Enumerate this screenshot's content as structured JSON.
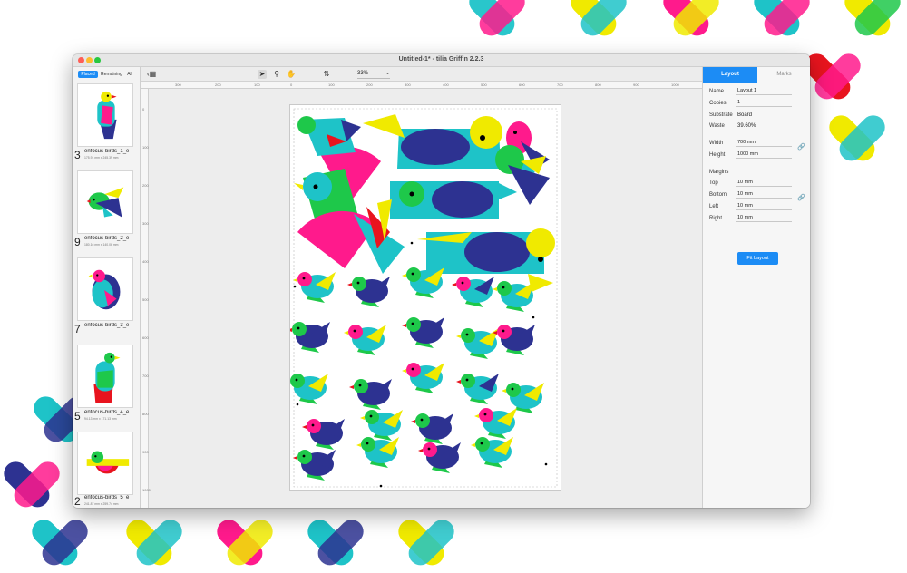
{
  "window": {
    "title": "Untitled-1* - tilia Griffin 2.2.3"
  },
  "sidebar": {
    "filter_tabs": [
      {
        "label": "Placed",
        "selected": true
      },
      {
        "label": "Remaining",
        "selected": false
      },
      {
        "label": "All",
        "selected": false
      }
    ],
    "items": [
      {
        "count": "3",
        "name": "enfocus-birds_1_e",
        "size": "175.91 mm x 245.39 mm"
      },
      {
        "count": "9",
        "name": "enfocus-birds_2_e",
        "size": "180.16 mm x 140.06 mm"
      },
      {
        "count": "7",
        "name": "enfocus-birds_3_e",
        "size": ""
      },
      {
        "count": "5",
        "name": "enfocus-birds_4_e",
        "size": "94.13 mm x 171.13 mm"
      },
      {
        "count": "2",
        "name": "enfocus-birds_5_e",
        "size": "241.87 mm x 259.74 mm"
      }
    ]
  },
  "toolbar": {
    "zoom": "33%",
    "icons": [
      "sidebar-toggle-icon",
      "pointer-icon",
      "magnifier-icon",
      "hand-icon",
      "flip-icon"
    ]
  },
  "rulers": {
    "horizontal": [
      "300",
      "200",
      "100",
      "0",
      "100",
      "200",
      "300",
      "400",
      "500",
      "600",
      "700",
      "800",
      "900",
      "1000"
    ],
    "vertical": [
      "0",
      "100",
      "200",
      "300",
      "400",
      "500",
      "600",
      "700",
      "800",
      "900",
      "1000"
    ]
  },
  "inspector": {
    "tabs": [
      {
        "label": "Layout",
        "active": true
      },
      {
        "label": "Marks",
        "active": false
      }
    ],
    "name_label": "Name",
    "name_value": "Layout 1",
    "copies_label": "Copies",
    "copies_value": "1",
    "substrate_label": "Substrate",
    "substrate_value": "Board",
    "waste_label": "Waste",
    "waste_value": "39.60%",
    "width_label": "Width",
    "width_value": "700 mm",
    "height_label": "Height",
    "height_value": "1000 mm",
    "margins_label": "Margins",
    "top_label": "Top",
    "top_value": "10 mm",
    "bottom_label": "Bottom",
    "bottom_value": "10 mm",
    "left_label": "Left",
    "left_value": "10 mm",
    "right_label": "Right",
    "right_value": "10 mm",
    "fit_button": "Fit Layout"
  },
  "colors": {
    "accent": "#1c8cf5",
    "bird_palette": [
      "#ff1a8c",
      "#1ec3c8",
      "#1ec84a",
      "#f0ea00",
      "#2d3291",
      "#e8141e"
    ]
  }
}
